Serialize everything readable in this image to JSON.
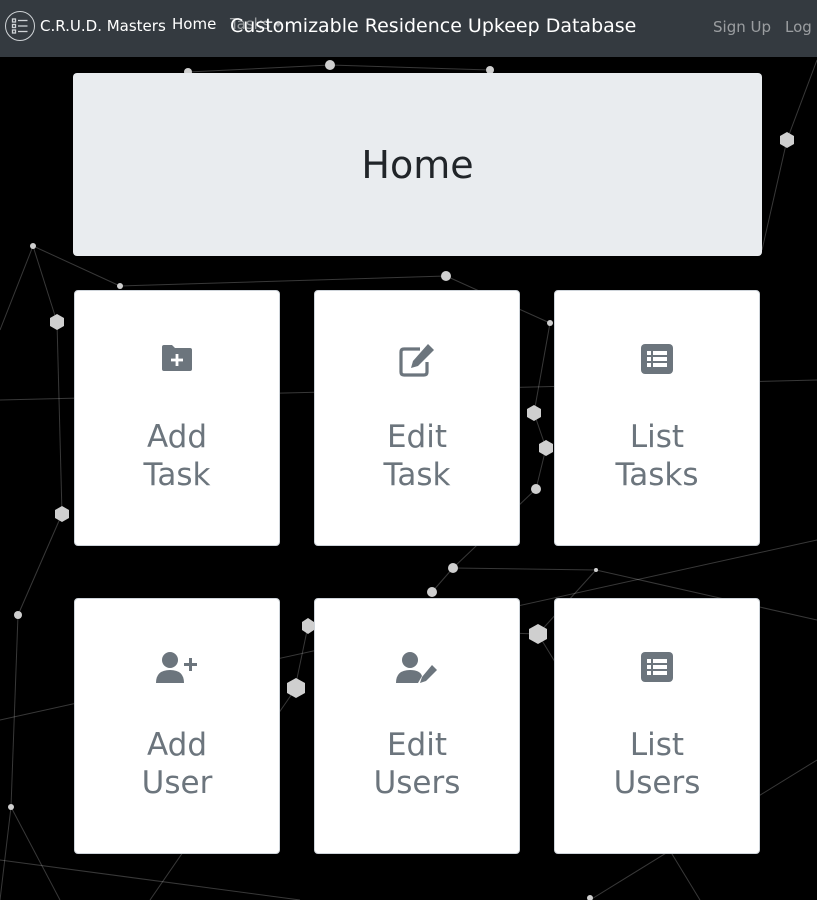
{
  "navbar": {
    "brand": "C.R.U.D. Masters",
    "links": {
      "home": "Home",
      "tasks": "Tasks",
      "signup": "Sign Up",
      "login": "Log"
    },
    "site_title": "Customizable Residence Upkeep Database"
  },
  "page": {
    "heading": "Home"
  },
  "cards": [
    {
      "line1": "Add",
      "line2": "Task",
      "icon": "folder-plus-icon"
    },
    {
      "line1": "Edit",
      "line2": "Task",
      "icon": "edit-icon"
    },
    {
      "line1": "List",
      "line2": "Tasks",
      "icon": "list-icon"
    },
    {
      "line1": "Add",
      "line2": "User",
      "icon": "user-plus-icon"
    },
    {
      "line1": "Edit",
      "line2": "Users",
      "icon": "user-edit-icon"
    },
    {
      "line1": "List",
      "line2": "Users",
      "icon": "list-icon"
    }
  ],
  "colors": {
    "navbar_bg": "#343a40",
    "jumbotron_bg": "#e9ecef",
    "card_text": "#6c757d",
    "page_bg": "#000000"
  }
}
